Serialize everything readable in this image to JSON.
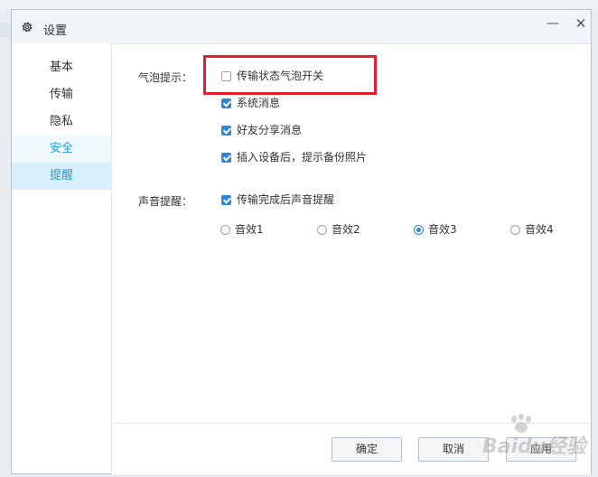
{
  "window": {
    "title": "设置",
    "minimize_glyph": "—",
    "close_glyph": "✕"
  },
  "sidebar": {
    "items": [
      {
        "label": "基本"
      },
      {
        "label": "传输"
      },
      {
        "label": "隐私"
      },
      {
        "label": "安全"
      },
      {
        "label": "提醒",
        "selected": true
      }
    ]
  },
  "bubble": {
    "label": "气泡提示：",
    "options": [
      {
        "label": "传输状态气泡开关",
        "checked": false
      },
      {
        "label": "系统消息",
        "checked": true
      },
      {
        "label": "好友分享消息",
        "checked": true
      },
      {
        "label": "插入设备后，提示备份照片",
        "checked": true
      }
    ]
  },
  "sound": {
    "label": "声音提醒：",
    "option": {
      "label": "传输完成后声音提醒",
      "checked": true
    },
    "effects": [
      {
        "label": "音效1",
        "selected": false
      },
      {
        "label": "音效2",
        "selected": false
      },
      {
        "label": "音效3",
        "selected": true
      },
      {
        "label": "音效4",
        "selected": false
      }
    ]
  },
  "footer": {
    "ok_label": "确定",
    "cancel_label": "取消",
    "apply_label": "应用"
  },
  "watermark": {
    "text": "Baidu经验"
  },
  "colors": {
    "accent": "#2b88d8",
    "nav_active_text": "#1a9fe0",
    "nav_active_bg": "#d7f0fc",
    "highlight_border": "#e41d2a"
  }
}
